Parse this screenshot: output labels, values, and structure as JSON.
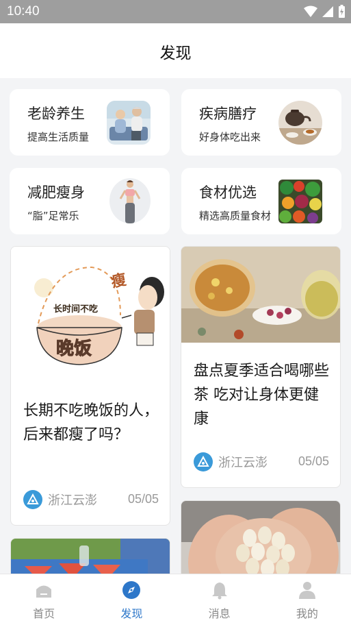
{
  "status_bar": {
    "time": "10:40"
  },
  "header": {
    "title": "发现"
  },
  "categories": [
    {
      "title": "老龄养生",
      "subtitle": "提高生活质量",
      "image": "elderly-couple-photo"
    },
    {
      "title": "疾病膳疗",
      "subtitle": "好身体吃出来",
      "image": "tea-set-photo"
    },
    {
      "title": "减肥瘦身",
      "subtitle": "“脂”足常乐",
      "image": "slim-woman-photo"
    },
    {
      "title": "食材优选",
      "subtitle": "精选高质量食材",
      "image": "vegetables-photo"
    }
  ],
  "feed": [
    {
      "title": "长期不吃晚饭的人，后来都瘦了吗？",
      "source": "浙江云澎",
      "date": "05/05",
      "image_text": {
        "bubble": "长时间不吃",
        "bowl": "晚饭",
        "side": "瘦"
      }
    },
    {
      "title": "盘点夏季适合喝哪些茶 吃对让身体更健康",
      "source": "浙江云澎",
      "date": "05/05"
    }
  ],
  "bottom_nav": [
    {
      "label": "首页",
      "icon": "home-icon"
    },
    {
      "label": "发现",
      "icon": "compass-icon",
      "active": true
    },
    {
      "label": "消息",
      "icon": "bell-icon"
    },
    {
      "label": "我的",
      "icon": "user-icon"
    }
  ],
  "colors": {
    "accent": "#2d77c9",
    "source_logo": "#3a9ad9",
    "background": "#f3f4f6"
  }
}
